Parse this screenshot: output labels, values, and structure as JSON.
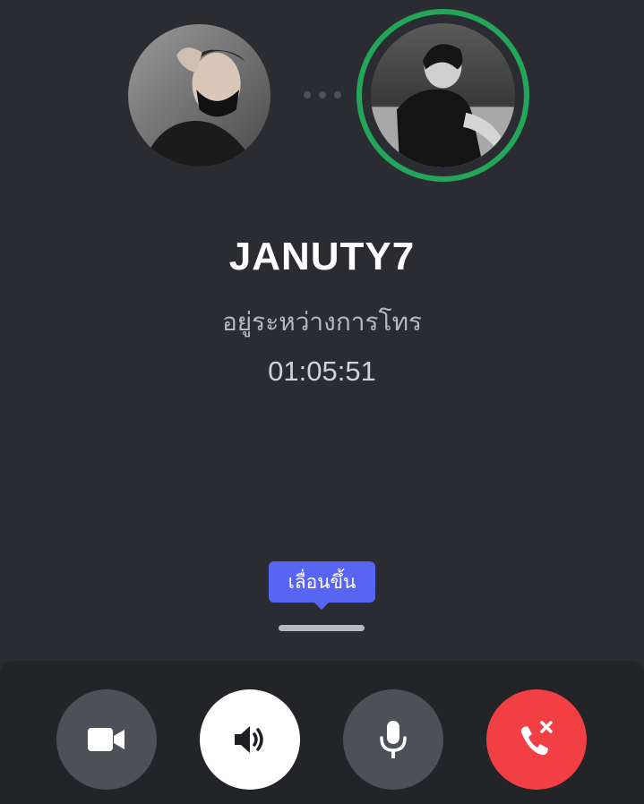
{
  "call": {
    "username": "JANUTY7",
    "status": "อยู่ระหว่างการโทร",
    "duration": "01:05:51"
  },
  "tooltip": {
    "label": "เลื่อนขึ้น"
  },
  "controls": [
    {
      "name": "video",
      "icon": "video-camera-icon"
    },
    {
      "name": "speaker",
      "icon": "speaker-icon"
    },
    {
      "name": "microphone",
      "icon": "microphone-icon"
    },
    {
      "name": "hang-up",
      "icon": "phone-hangup-icon"
    }
  ],
  "colors": {
    "background": "#2b2c31",
    "panel": "#232428",
    "speaking_ring": "#23a55a",
    "tooltip": "#5865f2",
    "hangup": "#f23f43",
    "button_gray": "#4e5058"
  }
}
